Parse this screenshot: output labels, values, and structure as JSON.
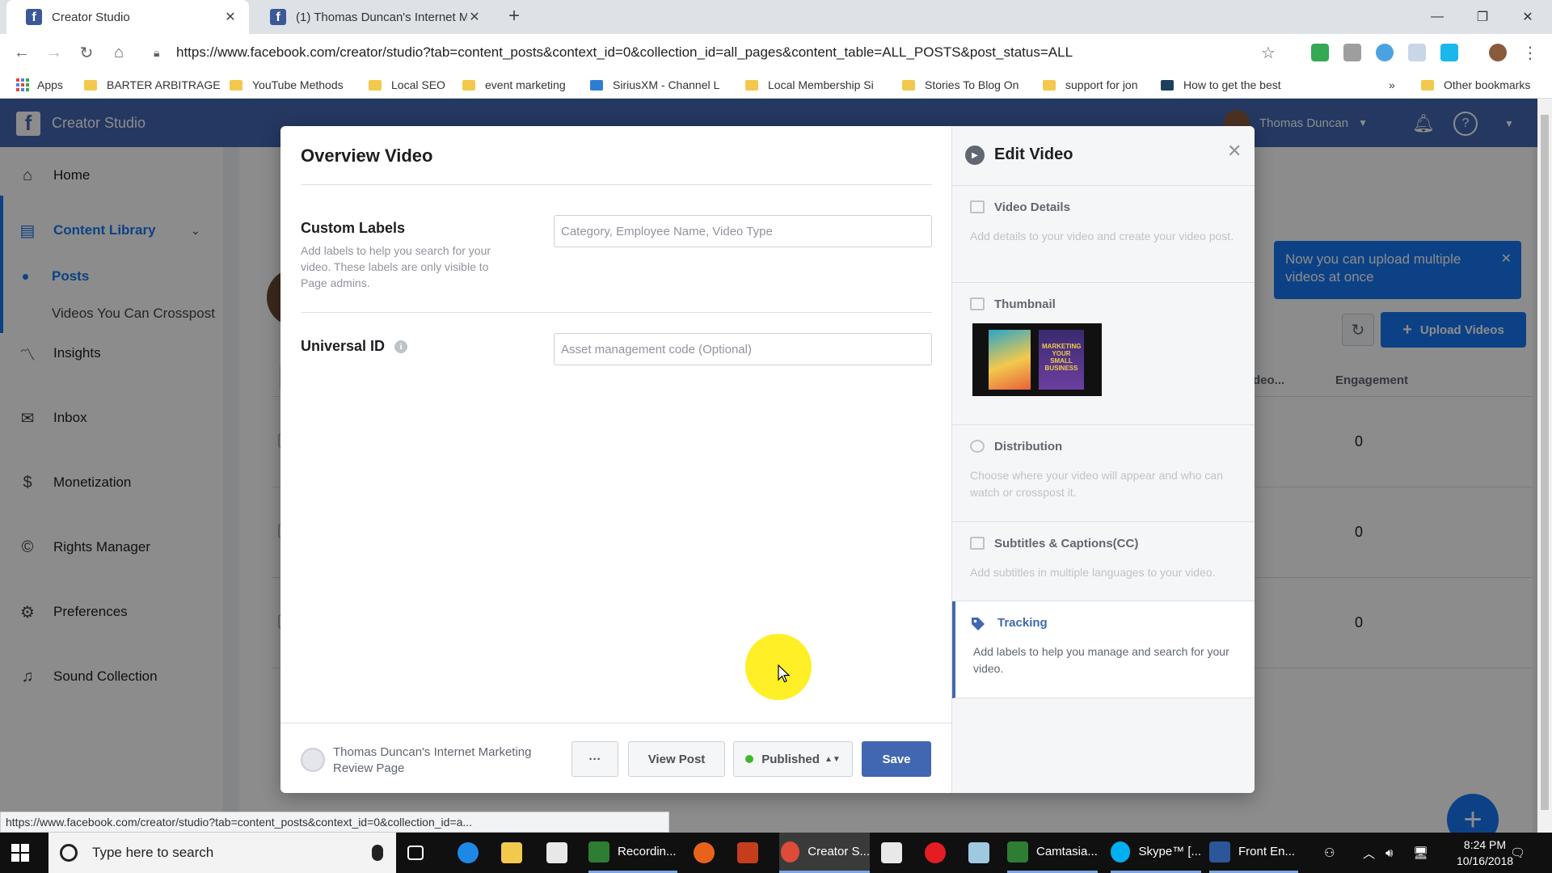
{
  "browser": {
    "tabs": [
      {
        "title": "Creator Studio",
        "active": true
      },
      {
        "title": "(1) Thomas Duncan's Internet M",
        "active": false
      }
    ],
    "url": "https://www.facebook.com/creator/studio?tab=content_posts&context_id=0&collection_id=all_pages&content_table=ALL_POSTS&post_status=ALL",
    "bookmarks": [
      "Apps",
      "BARTER ARBITRAGE",
      "YouTube Methods",
      "Local SEO",
      "event marketing",
      "SiriusXM - Channel L",
      "Local Membership Si",
      "Stories To Blog On",
      "support for jon",
      "How to get the best",
      "Other bookmarks"
    ],
    "bookmarks_more": "»",
    "status_url": "https://www.facebook.com/creator/studio?tab=content_posts&context_id=0&collection_id=a..."
  },
  "app": {
    "title": "Creator Studio",
    "user_name": "Thomas Duncan",
    "sidebar": {
      "home": "Home",
      "content_library": "Content Library",
      "posts": "Posts",
      "crosspost": "Videos You Can Crosspost",
      "insights": "Insights",
      "inbox": "Inbox",
      "monetization": "Monetization",
      "rights_manager": "Rights Manager",
      "preferences": "Preferences",
      "sound_collection": "Sound Collection"
    },
    "toast": "Now you can upload multiple videos at once",
    "upload_label": "Upload Videos",
    "columns": {
      "video": "deo...",
      "engagement": "Engagement"
    },
    "engagement_values": [
      "0",
      "0",
      "0"
    ]
  },
  "modal": {
    "title": "Overview Video",
    "custom_labels": {
      "label": "Custom Labels",
      "help": "Add labels to help you search for your video. These labels are only visible to Page admins.",
      "placeholder": "Category, Employee Name, Video Type"
    },
    "universal_id": {
      "label": "Universal ID",
      "placeholder": "Asset management code (Optional)"
    },
    "footer": {
      "page_name": "Thomas Duncan's Internet Marketing Review Page",
      "more": "···",
      "view_post": "View Post",
      "status": "Published",
      "save": "Save"
    },
    "edit": {
      "title": "Edit Video",
      "steps": [
        {
          "title": "Video Details",
          "desc": "Add details to your video and create your video post."
        },
        {
          "title": "Thumbnail",
          "desc": ""
        },
        {
          "title": "Distribution",
          "desc": "Choose where your video will appear and who can watch or crosspost it."
        },
        {
          "title": "Subtitles & Captions(CC)",
          "desc": "Add subtitles in multiple languages to your video."
        },
        {
          "title": "Tracking",
          "desc": "Add labels to help you manage and search for your video."
        }
      ],
      "thumbnail_text": "MARKETING YOUR SMALL BUSINESS"
    }
  },
  "taskbar": {
    "search_placeholder": "Type here to search",
    "apps": [
      "Recordin...",
      "Creator S...",
      "Camtasia...",
      "Skype™ [...",
      "Front En..."
    ],
    "time": "8:24 PM",
    "date": "10/16/2018"
  },
  "colors": {
    "facebook_blue": "#4267b2",
    "accent_blue": "#1877f2",
    "published_green": "#42b72a",
    "cursor_highlight": "#ffec00"
  }
}
